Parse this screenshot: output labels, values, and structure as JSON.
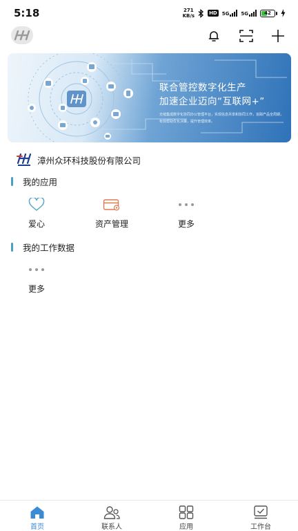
{
  "status_bar": {
    "time": "5:18",
    "net_speed_value": "271",
    "net_speed_unit": "KB/s",
    "hd_badge": "HD",
    "signal1_label": "5G",
    "signal2_label": "5G",
    "battery_level": "42"
  },
  "banner": {
    "title": "联合管控数字化生产",
    "subtitle": "加速企业迈向“互联网+”",
    "description": "无缝集成数字化协同办公管理平台，实现信息共享和协同工作，追踪产品全周期，有效帮助优化决策，提升管理效率。"
  },
  "company": {
    "name": "漳州众环科技股份有限公司"
  },
  "my_apps": {
    "title": "我的应用",
    "items": [
      {
        "label": "爱心",
        "icon": "heart-icon"
      },
      {
        "label": "资产管理",
        "icon": "card-icon"
      },
      {
        "label": "更多",
        "icon": "more-dots-icon"
      }
    ]
  },
  "my_work_data": {
    "title": "我的工作数据",
    "items": [
      {
        "label": "更多",
        "icon": "more-dots-icon"
      }
    ]
  },
  "bottom_nav": {
    "items": [
      {
        "label": "首页",
        "icon": "home-icon",
        "active": true
      },
      {
        "label": "联系人",
        "icon": "contacts-icon",
        "active": false
      },
      {
        "label": "应用",
        "icon": "apps-grid-icon",
        "active": false
      },
      {
        "label": "工作台",
        "icon": "workbench-icon",
        "active": false
      }
    ]
  },
  "colors": {
    "accent": "#3a8bd3",
    "section_bar": "#4a9fc4",
    "heart": "#5aa9c9",
    "asset_card": "#e07a4e"
  }
}
